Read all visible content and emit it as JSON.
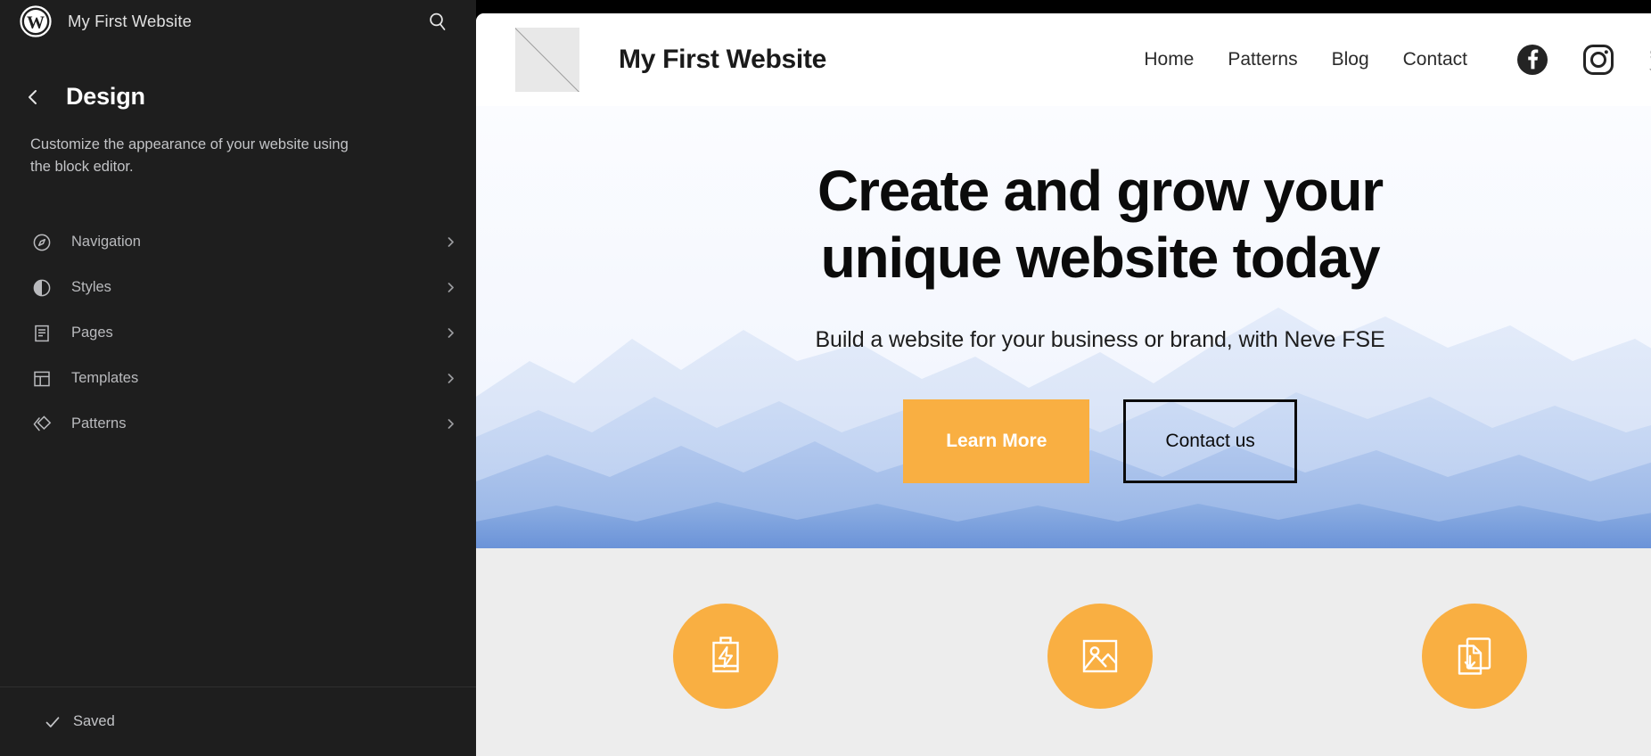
{
  "admin": {
    "site_name": "My First Website",
    "search_icon": "search-icon",
    "wp_logo_icon": "wordpress-logo-icon",
    "back_icon": "chevron-left-icon",
    "page_title": "Design",
    "description": "Customize the appearance of your website using the block editor.",
    "menu": [
      {
        "label": "Navigation",
        "icon": "compass-icon"
      },
      {
        "label": "Styles",
        "icon": "contrast-half-circle-icon"
      },
      {
        "label": "Pages",
        "icon": "document-lines-icon"
      },
      {
        "label": "Templates",
        "icon": "layout-template-icon"
      },
      {
        "label": "Patterns",
        "icon": "diamond-patterns-icon"
      }
    ],
    "footer": {
      "saved_label": "Saved",
      "saved_icon": "checkmark-icon"
    }
  },
  "preview": {
    "header": {
      "logo_icon": "placeholder-logo-icon",
      "title": "My First Website",
      "nav": [
        {
          "label": "Home"
        },
        {
          "label": "Patterns"
        },
        {
          "label": "Blog"
        },
        {
          "label": "Contact"
        }
      ],
      "socials": [
        {
          "name": "facebook-icon"
        },
        {
          "name": "instagram-icon"
        },
        {
          "name": "twitter-icon"
        }
      ]
    },
    "hero": {
      "heading": "Create and grow your unique website today",
      "subheading": "Build a website for your business or brand, with Neve FSE",
      "primary_button": "Learn More",
      "secondary_button": "Contact us"
    },
    "features": [
      {
        "icon": "battery-lightning-icon"
      },
      {
        "icon": "image-placeholder-icon"
      },
      {
        "icon": "document-download-icon"
      }
    ]
  },
  "colors": {
    "sidebar_bg": "#1e1e1e",
    "accent_orange": "#f9af42",
    "features_bg": "#ededed",
    "text_light": "#c3c4c7"
  }
}
